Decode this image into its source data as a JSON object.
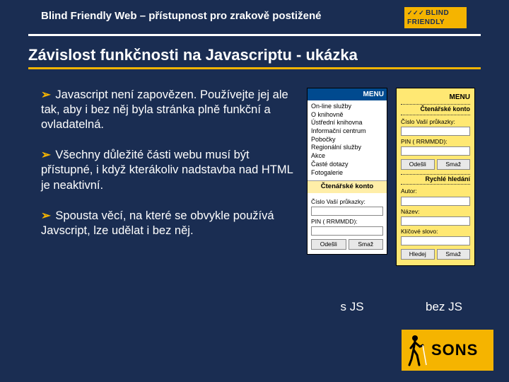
{
  "header": {
    "title": "Blind Friendly Web – přístupnost pro zrakově postižené",
    "logo_line1": "BLIND",
    "logo_line2": "FRIENDLY"
  },
  "section_title": "Závislost funkčnosti na Javascriptu - ukázka",
  "bullets": [
    "Javascript není zapovězen. Používejte jej ale tak, aby i bez něj byla stránka plně funkční a ovladatelná.",
    "Všechny důležité části webu musí být přístupné, i když kterákoliv nadstavba nad HTML je neaktivní.",
    "Spousta věcí, na které se obvykle používá Javscript, lze udělat i bez něj."
  ],
  "figA": {
    "menu_title": "MENU",
    "items": [
      "On-line služby",
      "O knihovně",
      "Ústřední knihovna",
      "Informační centrum",
      "Pobočky",
      "Regionální služby",
      "Akce",
      "Časté dotazy",
      "Fotogalerie"
    ],
    "konto_title": "Čtenářské konto",
    "lbl1": "Číslo Vaší průkazky:",
    "lbl2": "PIN ( RRMMDD):",
    "btn1": "Odešli",
    "btn2": "Smaž"
  },
  "figB": {
    "menu_title": "MENU",
    "sec1": "Čtenářské konto",
    "lbl1": "Číslo Vaší průkazky:",
    "lbl2": "PIN ( RRMMDD):",
    "btn_a1": "Odešli",
    "btn_a2": "Smaž",
    "sec2": "Rychlé hledání",
    "lbl3": "Autor:",
    "lbl4": "Název:",
    "lbl5": "Klíčové slovo:",
    "btn_b1": "Hledej",
    "btn_b2": "Smaž"
  },
  "captions": {
    "with_js": "s JS",
    "without_js": "bez JS"
  },
  "sons": "SONS"
}
